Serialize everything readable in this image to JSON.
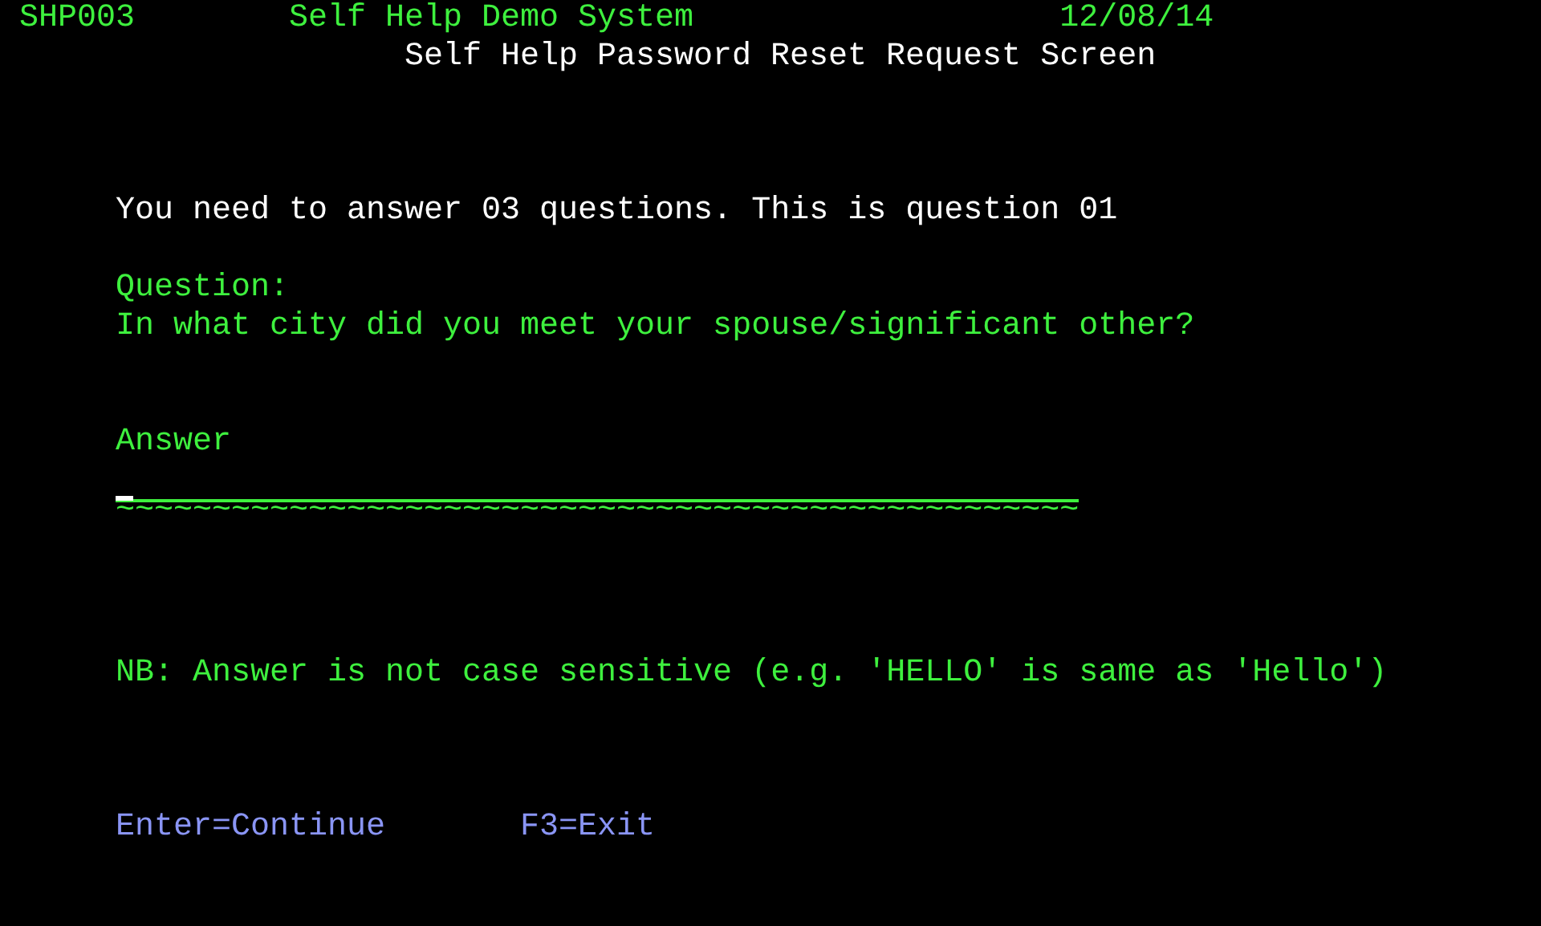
{
  "header": {
    "program_id": "SHP003",
    "system_title": "Self Help Demo System",
    "date": "12/08/14",
    "screen_title": "Self Help Password Reset Request Screen"
  },
  "message": "You need to answer 03 questions. This is question 01",
  "question": {
    "label": "Question:",
    "text": "In what city did you meet your spouse/significant other?"
  },
  "answer": {
    "label": "Answer",
    "fill_marks": "~~~~~~~~~~~~~~~~~~~~~~~~~~~~~~~~~~~~~~~~~~~~~~~~~~"
  },
  "note": "NB: Answer is not case sensitive (e.g. 'HELLO' is same as 'Hello')",
  "function_keys": [
    {
      "label": "Enter=Continue"
    },
    {
      "label": "F3=Exit"
    }
  ]
}
